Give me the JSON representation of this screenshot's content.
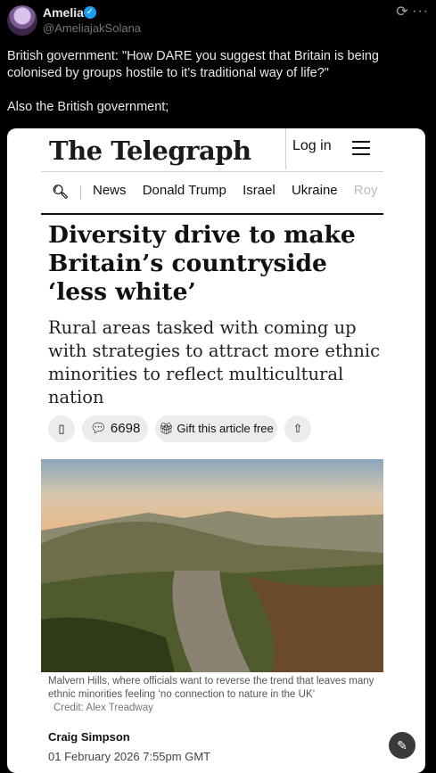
{
  "post": {
    "author_name": "Amelia",
    "handle": "@AmeliajakSolana",
    "verified_icon": "verified-badge-icon",
    "text_line1": "British government: \"How DARE you suggest that Britain is being colonised by groups hostile to it's traditional way of life?\"",
    "text_line2": "Also the British government;"
  },
  "telegraph": {
    "logo": "The Telegraph",
    "login_label": "Log in",
    "nav_items": [
      "News",
      "Donald Trump",
      "Israel",
      "Ukraine",
      "Roy"
    ],
    "headline": "Diversity drive to make Britain’s countryside ‘less white’",
    "standfirst": "Rural areas tasked with coming up with strategies to attract more ethnic minorities to reflect multicultural nation",
    "comments_count": "6698",
    "gift_label": "Gift this article free",
    "caption": "Malvern Hills, where officials want to reverse the trend that leaves many ethnic minorities feeling ‘no connection to nature in the UK’",
    "credit": "Credit: Alex Treadway",
    "author": "Craig Simpson",
    "date": "01 February 2026 7:55pm GMT"
  },
  "colors": {
    "background": "#000000",
    "verified": "#1d9bf0",
    "card": "#ffffff"
  }
}
